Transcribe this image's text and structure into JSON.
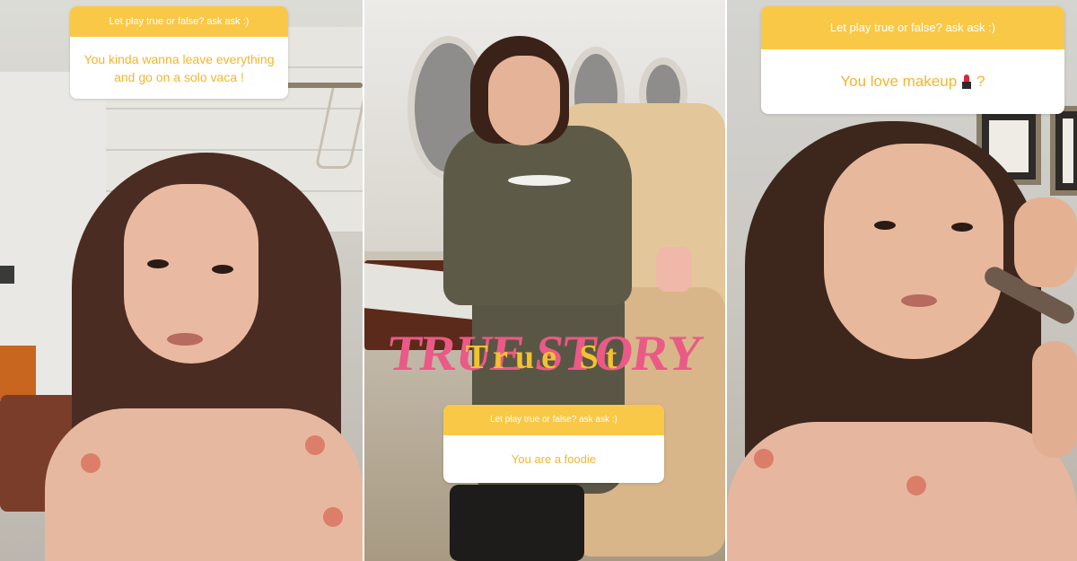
{
  "panels": [
    {
      "question_header": "Let play true or false? ask ask :)",
      "answer_text": "You kinda wanna leave everything and go on a solo vaca !"
    },
    {
      "question_header": "Let play true or false? ask ask :)",
      "answer_text": "You are a foodie",
      "sticker_back_text": "TRUE STORY",
      "sticker_front_text": "True St"
    },
    {
      "question_header": "Let play true or false? ask ask :)",
      "answer_text_before": "You love makeup",
      "answer_emoji": "lipstick-icon",
      "answer_text_after": "?"
    }
  ],
  "colors": {
    "sticker_header_yellow": "#f9c847",
    "sticker_answer_text": "#f4b52c",
    "true_story_pink": "#ea5a86",
    "true_story_yellow": "#f2c230"
  }
}
